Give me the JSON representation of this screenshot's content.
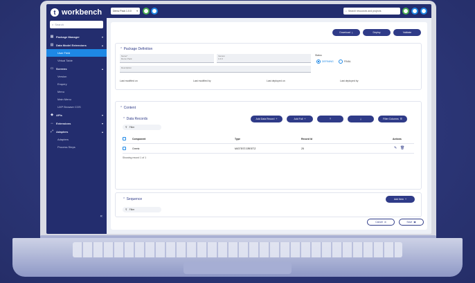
{
  "app": {
    "brand": "workbench"
  },
  "sidebar": {
    "search_placeholder": "Search",
    "items": [
      {
        "label": "Package Manager",
        "icon": "package-icon"
      },
      {
        "label": "Data Model Extensions",
        "icon": "data-model-icon",
        "subitems": [
          "User Field",
          "Virtual Table"
        ]
      },
      {
        "label": "Screens",
        "icon": "screen-icon",
        "subitems": [
          "Version",
          "Enquiry",
          "Menu",
          "Main Menu",
          "UXP Browser COS"
        ]
      },
      {
        "label": "APIs",
        "icon": "api-icon"
      },
      {
        "label": "Extensions",
        "icon": "extension-icon"
      },
      {
        "label": "Adapters",
        "icon": "adapter-icon",
        "subitems": [
          "Adapters",
          "Process Steps"
        ]
      }
    ],
    "collapse_glyph": "«"
  },
  "topbar": {
    "environment": "Demo Pack 1.0.0",
    "search_placeholder": "Search resources and projects"
  },
  "actions": {
    "download": "Download",
    "deploy": "Deploy",
    "validate": "Validate"
  },
  "package_definition": {
    "title": "Package Definition",
    "name_label": "Name*",
    "name_value": "Demo Pack",
    "version_label": "Version",
    "version_value": "1.0.0",
    "status_label": "Status",
    "status_options": [
      "DEFINING",
      "FINAL"
    ],
    "description_label": "Description",
    "last_modified_on": "Last modified on",
    "last_modified_by": "Last modified by",
    "last_deployed_on": "Last deployed on",
    "last_deployed_by": "Last deployed by"
  },
  "content": {
    "title": "Content",
    "data_records": {
      "title": "Data Records",
      "buttons": [
        "Add Data Record",
        "Add Full",
        "",
        "",
        "Filter Columns"
      ],
      "filter_label": "Filter",
      "columns": [
        "Component",
        "Type",
        "Record Id",
        "Actions"
      ],
      "rows": [
        {
          "component": "Greetz",
          "type": "MIGTEST.GREETZ",
          "record_id": "25"
        }
      ],
      "showing": "Showing record 1 of 1"
    },
    "sequences": {
      "title": "Sequence",
      "add_label": "Add Item",
      "filter_label": "Filter"
    }
  },
  "footer": {
    "cancel": "Cancel",
    "save": "Save"
  }
}
